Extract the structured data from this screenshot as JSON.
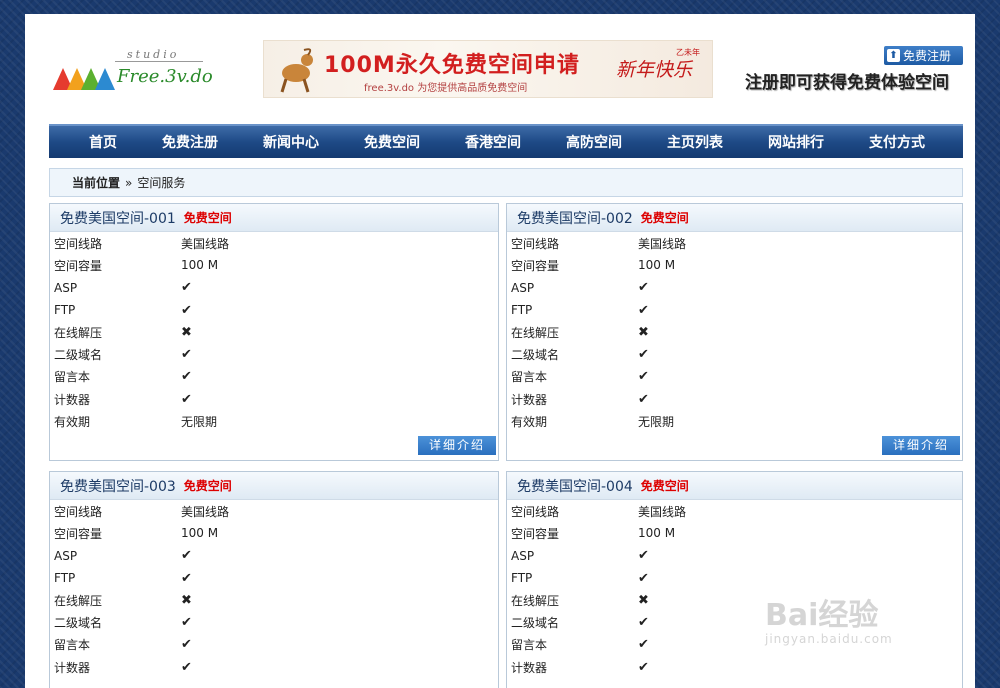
{
  "header": {
    "logo_studio": "studio",
    "logo_brand": "Free.3v.do",
    "banner_title": "100M永久免费空间申请",
    "banner_sub": "free.3v.do 为您提供高品质免费空间",
    "banner_greeting": "新年快乐",
    "banner_year": "乙未年",
    "register_label": "免费注册",
    "promo_text": "注册即可获得免费体验空间"
  },
  "nav": {
    "items": [
      "首页",
      "免费注册",
      "新闻中心",
      "免费空间",
      "香港空间",
      "高防空间",
      "主页列表",
      "网站排行",
      "支付方式"
    ]
  },
  "breadcrumb": {
    "current_label": "当前位置",
    "separator": "»",
    "page": "空间服务"
  },
  "cards": [
    {
      "title": "免费美国空间-001",
      "badge": "免费空间",
      "detail_label": "详细介绍",
      "rows": [
        {
          "k": "空间线路",
          "v": "美国线路"
        },
        {
          "k": "空间容量",
          "v": "100 M"
        },
        {
          "k": "ASP",
          "v": "✔"
        },
        {
          "k": "FTP",
          "v": "✔"
        },
        {
          "k": "在线解压",
          "v": "✖"
        },
        {
          "k": "二级域名",
          "v": "✔"
        },
        {
          "k": "留言本",
          "v": "✔"
        },
        {
          "k": "计数器",
          "v": "✔"
        },
        {
          "k": "有效期",
          "v": "无限期"
        }
      ]
    },
    {
      "title": "免费美国空间-002",
      "badge": "免费空间",
      "detail_label": "详细介绍",
      "rows": [
        {
          "k": "空间线路",
          "v": "美国线路"
        },
        {
          "k": "空间容量",
          "v": "100 M"
        },
        {
          "k": "ASP",
          "v": "✔"
        },
        {
          "k": "FTP",
          "v": "✔"
        },
        {
          "k": "在线解压",
          "v": "✖"
        },
        {
          "k": "二级域名",
          "v": "✔"
        },
        {
          "k": "留言本",
          "v": "✔"
        },
        {
          "k": "计数器",
          "v": "✔"
        },
        {
          "k": "有效期",
          "v": "无限期"
        }
      ]
    },
    {
      "title": "免费美国空间-003",
      "badge": "免费空间",
      "rows": [
        {
          "k": "空间线路",
          "v": "美国线路"
        },
        {
          "k": "空间容量",
          "v": "100 M"
        },
        {
          "k": "ASP",
          "v": "✔"
        },
        {
          "k": "FTP",
          "v": "✔"
        },
        {
          "k": "在线解压",
          "v": "✖"
        },
        {
          "k": "二级域名",
          "v": "✔"
        },
        {
          "k": "留言本",
          "v": "✔"
        },
        {
          "k": "计数器",
          "v": "✔"
        }
      ]
    },
    {
      "title": "免费美国空间-004",
      "badge": "免费空间",
      "rows": [
        {
          "k": "空间线路",
          "v": "美国线路"
        },
        {
          "k": "空间容量",
          "v": "100 M"
        },
        {
          "k": "ASP",
          "v": "✔"
        },
        {
          "k": "FTP",
          "v": "✔"
        },
        {
          "k": "在线解压",
          "v": "✖"
        },
        {
          "k": "二级域名",
          "v": "✔"
        },
        {
          "k": "留言本",
          "v": "✔"
        },
        {
          "k": "计数器",
          "v": "✔"
        }
      ]
    }
  ],
  "watermark": {
    "brand": "Bai经验",
    "url": "jingyan.baidu.com"
  },
  "colors": {
    "nav": "#1e4a86",
    "badge": "#dd0000",
    "check": "#6cad2c",
    "cross": "#e0443a",
    "button": "#2a6fbe"
  }
}
